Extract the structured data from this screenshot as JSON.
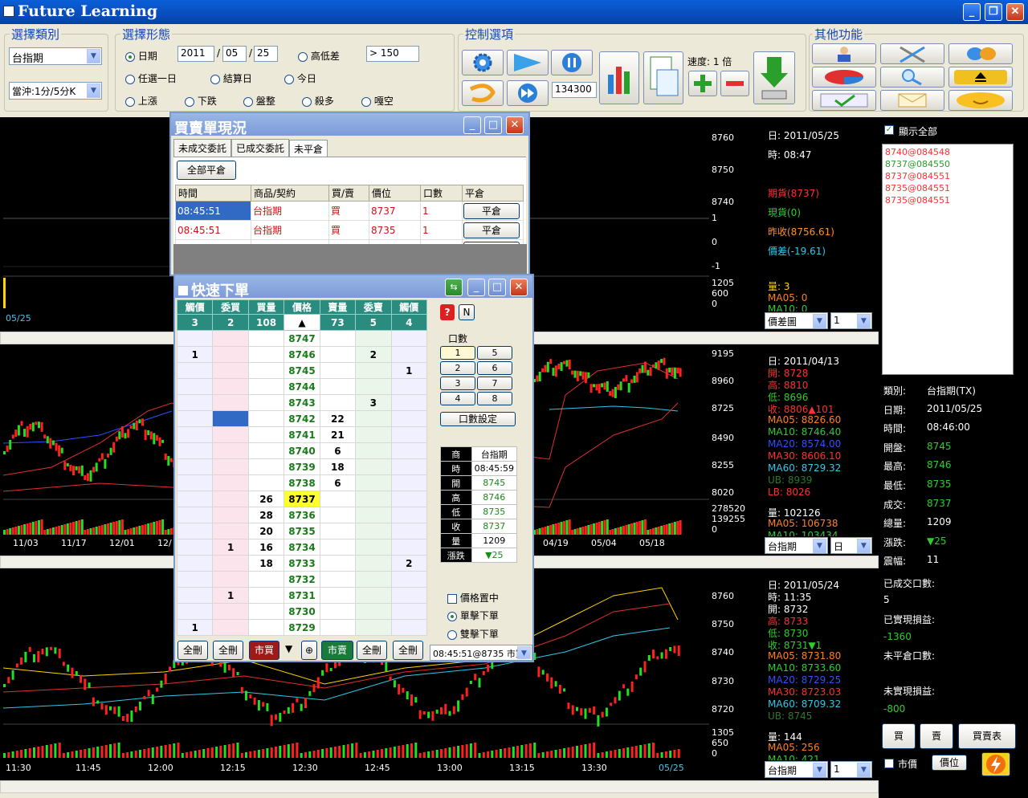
{
  "app": {
    "title": "Future Learning"
  },
  "groups": {
    "category": {
      "label": "選擇類別",
      "product": "台指期",
      "interval": "當沖:1分/5分K"
    },
    "pattern": {
      "label": "選擇形態",
      "opt_date": "日期",
      "year": "2011",
      "month": "05",
      "day": "25",
      "opt_highlow": "高低差",
      "highlow_val": "> 150",
      "opt_anyday": "任選一日",
      "opt_settle": "結算日",
      "opt_today": "今日",
      "opt_up": "上漲",
      "opt_down": "下跌",
      "opt_flat": "盤整",
      "opt_killlong": "殺多",
      "opt_squeezeshort": "嘎空"
    },
    "control": {
      "label": "控制選項",
      "speed": "速度: 1 倍",
      "counter": "134300"
    },
    "other": {
      "label": "其他功能"
    }
  },
  "pane1": {
    "yticks": [
      "8760",
      "8750",
      "8740",
      "1",
      "0",
      "-1"
    ],
    "vol_ticks": [
      "1205",
      "600",
      "0"
    ],
    "date": "05/25",
    "info": {
      "day": "日: 2011/05/25",
      "time": "時: 08:47",
      "fut": "期貨(8737)",
      "spot": "現貨(0)",
      "prev": "昨收(8756.61)",
      "spread": "價差(-19.61)",
      "vol": "量: 3",
      "ma05": "MA05: 0",
      "ma10": "MA10: 0"
    },
    "select1": "價差圖",
    "select2": "1"
  },
  "pane2": {
    "yticks": [
      "9195",
      "8960",
      "8725",
      "8490",
      "8255",
      "8020"
    ],
    "vol_ticks": [
      "278520",
      "139255",
      "0"
    ],
    "xticks": [
      "11/03",
      "11/17",
      "12/01",
      "12/",
      "04/19",
      "05/04",
      "05/18"
    ],
    "info": {
      "day": "日: 2011/04/13",
      "open": "開: 8728",
      "high": "高: 8810",
      "low": "低: 8696",
      "close": "收: 8806▲101",
      "ma05": "MA05: 8826.60",
      "ma10": "MA10: 8746.40",
      "ma20": "MA20: 8574.00",
      "ma30": "MA30: 8606.10",
      "ma60": "MA60: 8729.32",
      "ub": "UB: 8939",
      "lb": "LB: 8026",
      "vol": "量: 102126",
      "vma05": "MA05: 106738",
      "vma10": "MA10: 103434"
    },
    "select1": "台指期",
    "select2": "日"
  },
  "pane3": {
    "yticks": [
      "8760",
      "8750",
      "8740",
      "8730",
      "8720"
    ],
    "vol_ticks": [
      "1305",
      "650",
      "0"
    ],
    "xticks": [
      "11:30",
      "11:45",
      "12:00",
      "12:15",
      "12:30",
      "12:45",
      "13:00",
      "13:15",
      "13:30",
      "05/25"
    ],
    "info": {
      "day": "日: 2011/05/24",
      "time": "時: 11:35",
      "open": "開: 8732",
      "high": "高: 8733",
      "low": "低: 8730",
      "close": "收: 8731▼1",
      "ma05": "MA05: 8731.80",
      "ma10": "MA10: 8733.60",
      "ma20": "MA20: 8729.25",
      "ma30": "MA30: 8723.03",
      "ma60": "MA60: 8709.32",
      "ub": "UB: 8745",
      "vol": "量: 144",
      "vma05": "MA05: 256",
      "vma10": "MA10: 421"
    },
    "select1": "台指期",
    "select2": "1"
  },
  "right": {
    "show_all": "顯示全部",
    "fills": [
      {
        "t": "8740@084548",
        "c": "#ff3030"
      },
      {
        "t": "8737@084550",
        "c": "#2a9a2a"
      },
      {
        "t": "8737@084551",
        "c": "#ff3030"
      },
      {
        "t": "8735@084551",
        "c": "#ff3030"
      },
      {
        "t": "8735@084551",
        "c": "#ff3030"
      }
    ],
    "kv": [
      {
        "k": "類別:",
        "v": "台指期(TX)",
        "c": "#fff"
      },
      {
        "k": "日期:",
        "v": "2011/05/25",
        "c": "#fff"
      },
      {
        "k": "時間:",
        "v": "08:46:00",
        "c": "#fff"
      },
      {
        "k": "開盤:",
        "v": "8745",
        "c": "#2ecc2e"
      },
      {
        "k": "最高:",
        "v": "8746",
        "c": "#2ecc2e"
      },
      {
        "k": "最低:",
        "v": "8735",
        "c": "#2ecc2e"
      },
      {
        "k": "成交:",
        "v": "8737",
        "c": "#2ecc2e"
      },
      {
        "k": "總量:",
        "v": "1209",
        "c": "#fff"
      },
      {
        "k": "漲跌:",
        "v": "▼25",
        "c": "#2ecc2e"
      },
      {
        "k": "震幅:",
        "v": "11",
        "c": "#fff"
      }
    ],
    "filled_label": "已成交口數:",
    "filled_val": "5",
    "realized_label": "已實現損益:",
    "realized_val": "-1360",
    "open_label": "未平倉口數:",
    "unreal_label": "未實現損益:",
    "unreal_val": "-800",
    "buy": "買",
    "sell": "賣",
    "orderlist": "買賣表",
    "market": "市價",
    "price": "價位"
  },
  "orders": {
    "title": "買賣單現況",
    "tabs": [
      "未成交委託",
      "已成交委託",
      "未平倉"
    ],
    "closeall": "全部平倉",
    "headers": [
      "時間",
      "商品/契約",
      "買/賣",
      "價位",
      "口數",
      "平倉"
    ],
    "rows": [
      {
        "time": "08:45:51",
        "prod": "台指期",
        "bs": "買",
        "price": "8737",
        "qty": "1",
        "btn": "平倉"
      },
      {
        "time": "08:45:51",
        "prod": "台指期",
        "bs": "買",
        "price": "8735",
        "qty": "1",
        "btn": "平倉"
      },
      {
        "time": "08:45:51",
        "prod": "台指期",
        "bs": "買",
        "price": "8735",
        "qty": "1",
        "btn": "平倉"
      }
    ]
  },
  "quick": {
    "title": "快速下單",
    "headers": [
      "觸價",
      "委買",
      "買量",
      "價格",
      "賣量",
      "委賣",
      "觸價"
    ],
    "sub": [
      "3",
      "2",
      "108",
      "▲",
      "73",
      "5",
      "4"
    ],
    "rows": [
      [
        "",
        "",
        "",
        "8747",
        "",
        "",
        ""
      ],
      [
        "1",
        "",
        "",
        "8746",
        "",
        "2",
        ""
      ],
      [
        "",
        "",
        "",
        "8745",
        "",
        "",
        "1"
      ],
      [
        "",
        "",
        "",
        "8744",
        "",
        "",
        ""
      ],
      [
        "",
        "",
        "",
        "8743",
        "",
        "3",
        ""
      ],
      [
        "",
        "",
        "",
        "8742",
        "22",
        "",
        ""
      ],
      [
        "",
        "",
        "",
        "8741",
        "21",
        "",
        ""
      ],
      [
        "",
        "",
        "",
        "8740",
        "6",
        "",
        ""
      ],
      [
        "",
        "",
        "",
        "8739",
        "18",
        "",
        ""
      ],
      [
        "",
        "",
        "",
        "8738",
        "6",
        "",
        ""
      ],
      [
        "",
        "",
        "26",
        "8737",
        "",
        "",
        ""
      ],
      [
        "",
        "",
        "28",
        "8736",
        "",
        "",
        ""
      ],
      [
        "",
        "",
        "20",
        "8735",
        "",
        "",
        ""
      ],
      [
        "",
        "1",
        "16",
        "8734",
        "",
        "",
        ""
      ],
      [
        "",
        "",
        "18",
        "8733",
        "",
        "",
        "2"
      ],
      [
        "",
        "",
        "",
        "8732",
        "",
        "",
        ""
      ],
      [
        "",
        "1",
        "",
        "8731",
        "",
        "",
        ""
      ],
      [
        "",
        "",
        "",
        "8730",
        "",
        "",
        ""
      ],
      [
        "1",
        "",
        "",
        "8729",
        "",
        "",
        ""
      ]
    ],
    "qty_label": "口數",
    "qty_btns": [
      "1",
      "5",
      "2",
      "6",
      "3",
      "7",
      "4",
      "8"
    ],
    "qty_setting": "口數設定",
    "quote": [
      [
        "商",
        "台指期"
      ],
      [
        "時",
        "08:45:59"
      ],
      [
        "開",
        "8745"
      ],
      [
        "高",
        "8746"
      ],
      [
        "低",
        "8735"
      ],
      [
        "收",
        "8737"
      ],
      [
        "量",
        "1209"
      ],
      [
        "漲跌",
        "▼25"
      ]
    ],
    "center": "價格置中",
    "single": "單擊下單",
    "double": "雙擊下單",
    "bottom": [
      "全刪",
      "全刪",
      "市買",
      "▼",
      "⊕",
      "市賣",
      "全刪",
      "全刪"
    ],
    "log": "08:45:51@8735 市買",
    "n": "N"
  }
}
